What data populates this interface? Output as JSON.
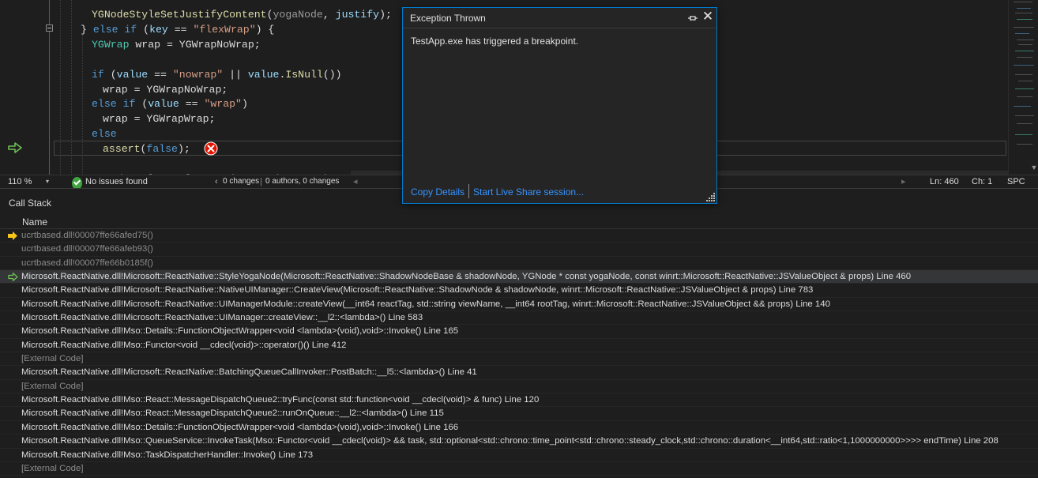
{
  "editor": {
    "lines": [
      {
        "tokens": [
          {
            "t": "YGNodeStyleSetJustifyContent",
            "c": "fn"
          },
          {
            "t": "(",
            "c": "va"
          },
          {
            "t": "yogaNode",
            "c": "pm"
          },
          {
            "t": ", ",
            "c": "va"
          },
          {
            "t": "justify",
            "c": "pa"
          },
          {
            "t": ");",
            "c": "va"
          }
        ]
      },
      {
        "tokens": [
          {
            "t": "} ",
            "c": "va"
          },
          {
            "t": "else if",
            "c": "kw"
          },
          {
            "t": " (",
            "c": "va"
          },
          {
            "t": "key",
            "c": "pa"
          },
          {
            "t": " == ",
            "c": "va"
          },
          {
            "t": "\"flexWrap\"",
            "c": "st"
          },
          {
            "t": ") {",
            "c": "va"
          }
        ]
      },
      {
        "tokens": [
          {
            "t": "YGWrap",
            "c": "ty"
          },
          {
            "t": " wrap = ",
            "c": "va"
          },
          {
            "t": "YGWrapNoWrap",
            "c": "va"
          },
          {
            "t": ";",
            "c": "va"
          }
        ]
      },
      {
        "tokens": []
      },
      {
        "tokens": [
          {
            "t": "if",
            "c": "kw"
          },
          {
            "t": " (",
            "c": "va"
          },
          {
            "t": "value",
            "c": "pa"
          },
          {
            "t": " == ",
            "c": "va"
          },
          {
            "t": "\"nowrap\"",
            "c": "st"
          },
          {
            "t": " || ",
            "c": "va"
          },
          {
            "t": "value",
            "c": "pa"
          },
          {
            "t": ".",
            "c": "va"
          },
          {
            "t": "IsNull",
            "c": "fn"
          },
          {
            "t": "())",
            "c": "va"
          }
        ]
      },
      {
        "tokens": [
          {
            "t": "wrap = ",
            "c": "va"
          },
          {
            "t": "YGWrapNoWrap",
            "c": "va"
          },
          {
            "t": ";",
            "c": "va"
          }
        ]
      },
      {
        "tokens": [
          {
            "t": "else if",
            "c": "kw"
          },
          {
            "t": " (",
            "c": "va"
          },
          {
            "t": "value",
            "c": "pa"
          },
          {
            "t": " == ",
            "c": "va"
          },
          {
            "t": "\"wrap\"",
            "c": "st"
          },
          {
            "t": ")",
            "c": "va"
          }
        ]
      },
      {
        "tokens": [
          {
            "t": "wrap = ",
            "c": "va"
          },
          {
            "t": "YGWrapWrap",
            "c": "va"
          },
          {
            "t": ";",
            "c": "va"
          }
        ]
      },
      {
        "tokens": [
          {
            "t": "else",
            "c": "kw"
          }
        ]
      },
      {
        "tokens": [
          {
            "t": "assert",
            "c": "fn"
          },
          {
            "t": "(",
            "c": "va"
          },
          {
            "t": "false",
            "c": "kw"
          },
          {
            "t": ");",
            "c": "va"
          }
        ]
      },
      {
        "tokens": []
      },
      {
        "tokens": [
          {
            "t": "YGNodeStyleSetFlexWrap(yogaNode, wrap);",
            "c": "va"
          }
        ]
      }
    ]
  },
  "statusbar": {
    "zoom": "110 %",
    "zoom_dropdown": "▾",
    "issues": "No issues found",
    "changes_chevron": "‹",
    "changes": "0 changes",
    "changes_sep": "|",
    "authors": "0 authors, 0 changes",
    "left_chevron": "◂",
    "right_chevron": "▸",
    "ln": "Ln: 460",
    "ch": "Ch: 1",
    "spc": "SPC"
  },
  "callstack": {
    "title": "Call Stack",
    "column_name": "Name",
    "rows": [
      {
        "label": "ucrtbased.dll!00007ffe66afed75()",
        "external": true,
        "marker": "current"
      },
      {
        "label": "ucrtbased.dll!00007ffe66afeb93()",
        "external": true,
        "marker": ""
      },
      {
        "label": "ucrtbased.dll!00007ffe66b0185f()",
        "external": true,
        "marker": ""
      },
      {
        "label": "Microsoft.ReactNative.dll!Microsoft::ReactNative::StyleYogaNode(Microsoft::ReactNative::ShadowNodeBase & shadowNode, YGNode * const yogaNode, const winrt::Microsoft::ReactNative::JSValueObject & props) Line 460",
        "external": false,
        "marker": "selected"
      },
      {
        "label": "Microsoft.ReactNative.dll!Microsoft::ReactNative::NativeUIManager::CreateView(Microsoft::ReactNative::ShadowNode & shadowNode, winrt::Microsoft::ReactNative::JSValueObject & props) Line 783",
        "external": false,
        "marker": ""
      },
      {
        "label": "Microsoft.ReactNative.dll!Microsoft::ReactNative::UIManagerModule::createView(__int64 reactTag, std::string viewName, __int64 rootTag, winrt::Microsoft::ReactNative::JSValueObject && props) Line 140",
        "external": false,
        "marker": ""
      },
      {
        "label": "Microsoft.ReactNative.dll!Microsoft::ReactNative::UIManager::createView::__l2::<lambda>() Line 583",
        "external": false,
        "marker": ""
      },
      {
        "label": "Microsoft.ReactNative.dll!Mso::Details::FunctionObjectWrapper<void <lambda>(void),void>::Invoke() Line 165",
        "external": false,
        "marker": ""
      },
      {
        "label": "Microsoft.ReactNative.dll!Mso::Functor<void __cdecl(void)>::operator()() Line 412",
        "external": false,
        "marker": ""
      },
      {
        "label": "[External Code]",
        "external": true,
        "marker": ""
      },
      {
        "label": "Microsoft.ReactNative.dll!Microsoft::ReactNative::BatchingQueueCallInvoker::PostBatch::__l5::<lambda>() Line 41",
        "external": false,
        "marker": ""
      },
      {
        "label": "[External Code]",
        "external": true,
        "marker": ""
      },
      {
        "label": "Microsoft.ReactNative.dll!Mso::React::MessageDispatchQueue2::tryFunc(const std::function<void __cdecl(void)> & func) Line 120",
        "external": false,
        "marker": ""
      },
      {
        "label": "Microsoft.ReactNative.dll!Mso::React::MessageDispatchQueue2::runOnQueue::__l2::<lambda>() Line 115",
        "external": false,
        "marker": ""
      },
      {
        "label": "Microsoft.ReactNative.dll!Mso::Details::FunctionObjectWrapper<void <lambda>(void),void>::Invoke() Line 166",
        "external": false,
        "marker": ""
      },
      {
        "label": "Microsoft.ReactNative.dll!Mso::QueueService::InvokeTask(Mso::Functor<void __cdecl(void)> && task, std::optional<std::chrono::time_point<std::chrono::steady_clock,std::chrono::duration<__int64,std::ratio<1,1000000000>>>> endTime) Line 208",
        "external": false,
        "marker": ""
      },
      {
        "label": "Microsoft.ReactNative.dll!Mso::TaskDispatcherHandler::Invoke() Line 173",
        "external": false,
        "marker": ""
      },
      {
        "label": "[External Code]",
        "external": true,
        "marker": ""
      }
    ]
  },
  "popup": {
    "title": "Exception Thrown",
    "close_glyph": "✕",
    "message": "TestApp.exe has triggered a breakpoint.",
    "copy_details": "Copy Details",
    "live_share": "Start Live Share session..."
  },
  "colors": {
    "accent": "#007acc",
    "link": "#3794ff",
    "breakpoint_red": "#e51400",
    "next_statement_yellow": "#f5c518",
    "return_arrow_green": "#6fbf55"
  }
}
